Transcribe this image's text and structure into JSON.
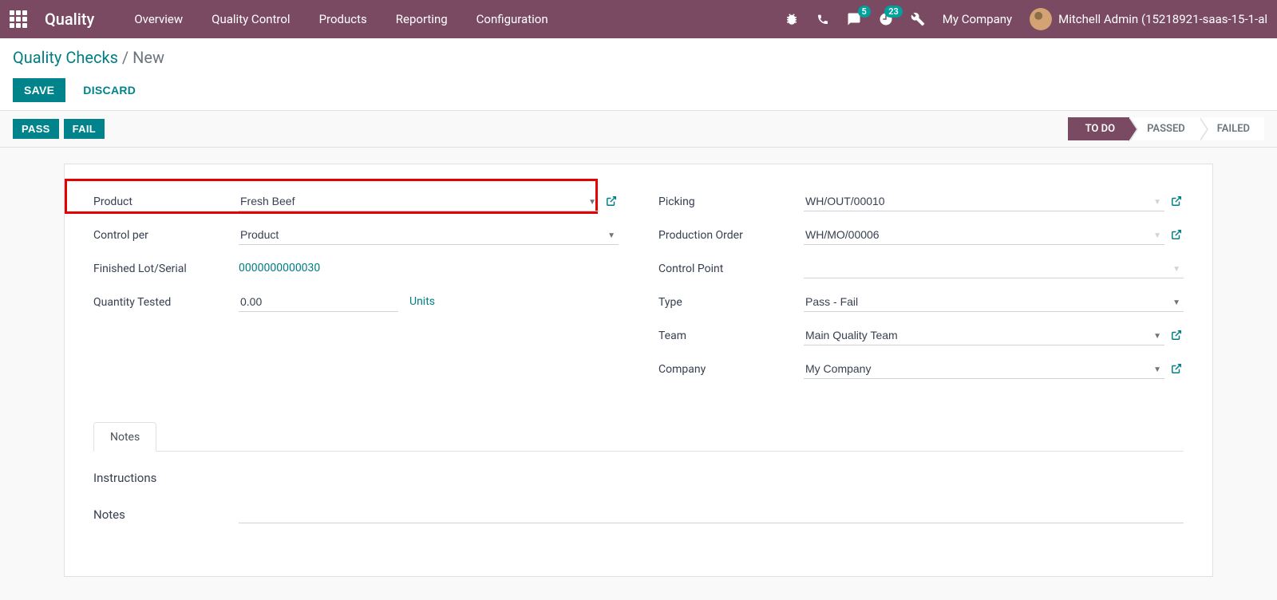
{
  "navbar": {
    "brand": "Quality",
    "menu": [
      "Overview",
      "Quality Control",
      "Products",
      "Reporting",
      "Configuration"
    ],
    "messages_count": "5",
    "activities_count": "23",
    "company": "My Company",
    "user": "Mitchell Admin (15218921-saas-15-1-al"
  },
  "breadcrumb": {
    "root": "Quality Checks",
    "current": "New"
  },
  "buttons": {
    "save": "SAVE",
    "discard": "DISCARD",
    "pass": "PASS",
    "fail": "FAIL"
  },
  "status": {
    "todo": "TO DO",
    "passed": "PASSED",
    "failed": "FAILED"
  },
  "form": {
    "left": {
      "product_label": "Product",
      "product_value": "Fresh Beef",
      "control_per_label": "Control per",
      "control_per_value": "Product",
      "lot_label": "Finished Lot/Serial",
      "lot_value": "0000000000030",
      "qty_label": "Quantity Tested",
      "qty_value": "0.00",
      "qty_unit": "Units"
    },
    "right": {
      "picking_label": "Picking",
      "picking_value": "WH/OUT/00010",
      "production_label": "Production Order",
      "production_value": "WH/MO/00006",
      "control_point_label": "Control Point",
      "control_point_value": "",
      "type_label": "Type",
      "type_value": "Pass - Fail",
      "team_label": "Team",
      "team_value": "Main Quality Team",
      "company_label": "Company",
      "company_value": "My Company"
    }
  },
  "tabs": {
    "notes": "Notes",
    "instructions_label": "Instructions",
    "notes_label": "Notes"
  }
}
